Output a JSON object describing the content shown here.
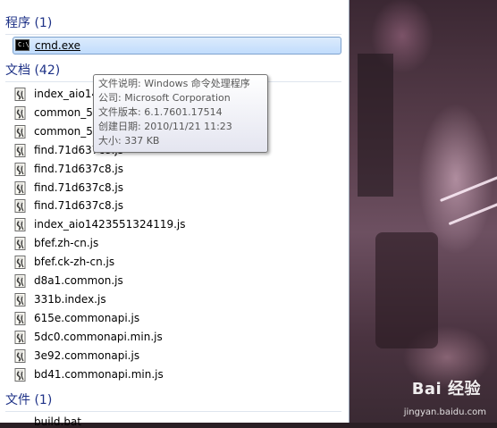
{
  "sections": {
    "programs": {
      "header": "程序 (1)"
    },
    "documents": {
      "header": "文档 (42)"
    },
    "files": {
      "header": "文件 (1)"
    }
  },
  "program_items": [
    {
      "name": "cmd.exe",
      "icon": "cmd-icon",
      "selected": true
    }
  ],
  "document_items": [
    {
      "name": "index_aio14",
      "icon": "js-file-icon"
    },
    {
      "name": "common_5c",
      "icon": "js-file-icon"
    },
    {
      "name": "common_5c",
      "icon": "js-file-icon"
    },
    {
      "name": "find.71d637c8.js",
      "icon": "js-file-icon"
    },
    {
      "name": "find.71d637c8.js",
      "icon": "js-file-icon"
    },
    {
      "name": "find.71d637c8.js",
      "icon": "js-file-icon"
    },
    {
      "name": "find.71d637c8.js",
      "icon": "js-file-icon"
    },
    {
      "name": "index_aio1423551324119.js",
      "icon": "js-file-icon"
    },
    {
      "name": "bfef.zh-cn.js",
      "icon": "js-file-icon"
    },
    {
      "name": "bfef.ck-zh-cn.js",
      "icon": "js-file-icon"
    },
    {
      "name": "d8a1.common.js",
      "icon": "js-file-icon"
    },
    {
      "name": "331b.index.js",
      "icon": "js-file-icon"
    },
    {
      "name": "615e.commonapi.js",
      "icon": "js-file-icon"
    },
    {
      "name": "5dc0.commonapi.min.js",
      "icon": "js-file-icon"
    },
    {
      "name": "3e92.commonapi.js",
      "icon": "js-file-icon"
    },
    {
      "name": "bd41.commonapi.min.js",
      "icon": "js-file-icon"
    }
  ],
  "file_items_partial": "build.bat",
  "tooltip": {
    "description": "文件说明: Windows 命令处理程序",
    "company": "公司: Microsoft Corporation",
    "version": "文件版本: 6.1.7601.17514",
    "created": "创建日期: 2010/11/21 11:23",
    "size": "大小: 337 KB"
  },
  "watermark": {
    "brand": "Bai 经验",
    "url": "jingyan.baidu.com"
  },
  "colors": {
    "section_header": "#1e3287",
    "selected_bg": "#c1dcfc",
    "selected_border": "#7da2ce"
  }
}
